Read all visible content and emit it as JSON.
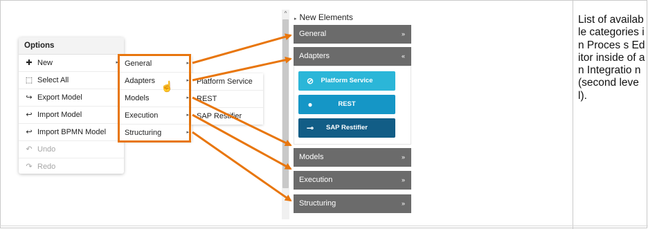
{
  "options_menu": {
    "title": "Options",
    "items": [
      {
        "label": "New",
        "icon": "plus-icon",
        "glyph": "✚",
        "has_submenu": true,
        "disabled": false
      },
      {
        "label": "Select All",
        "icon": "select-all-icon",
        "glyph": "⬚",
        "has_submenu": false,
        "disabled": false
      },
      {
        "label": "Export Model",
        "icon": "export-arrow-icon",
        "glyph": "↪",
        "has_submenu": false,
        "disabled": false
      },
      {
        "label": "Import Model",
        "icon": "import-arrow-icon",
        "glyph": "↩",
        "has_submenu": false,
        "disabled": false
      },
      {
        "label": "Import BPMN Model",
        "icon": "import-arrow-icon",
        "glyph": "↩",
        "has_submenu": false,
        "disabled": false
      },
      {
        "label": "Undo",
        "icon": "undo-icon",
        "glyph": "↶",
        "has_submenu": false,
        "disabled": true
      },
      {
        "label": "Redo",
        "icon": "redo-icon",
        "glyph": "↷",
        "has_submenu": false,
        "disabled": true
      }
    ]
  },
  "new_submenu": {
    "items": [
      "General",
      "Adapters",
      "Models",
      "Execution",
      "Structuring"
    ],
    "arrow_glyph": "▸"
  },
  "adapters_submenu": {
    "items": [
      "Platform Service",
      "REST",
      "SAP Restifier"
    ]
  },
  "palette": {
    "header": "New Elements",
    "header_glyph": "▸",
    "scroll_up_glyph": "^",
    "collapsed_glyph": "»",
    "expanded_glyph": "«",
    "categories": {
      "general": "General",
      "adapters": "Adapters",
      "models": "Models",
      "execution": "Execution",
      "structuring": "Structuring"
    },
    "adapter_buttons": [
      {
        "label": "Platform Service",
        "icon": "platform-service-icon",
        "glyph": "⊘",
        "color": "#2bb6d8"
      },
      {
        "label": "REST",
        "icon": "chat-bubble-icon",
        "glyph": "●",
        "color": "#1596c6"
      },
      {
        "label": "SAP Restifier",
        "icon": "connector-icon",
        "glyph": "⊸",
        "color": "#125d86"
      }
    ]
  },
  "caption": "List of available categories in Proces s Editor inside of an Integratio n (second level).",
  "colors": {
    "highlight": "#e8760d",
    "category_bar": "#6b6b6b"
  },
  "cursor_glyph": "☝"
}
